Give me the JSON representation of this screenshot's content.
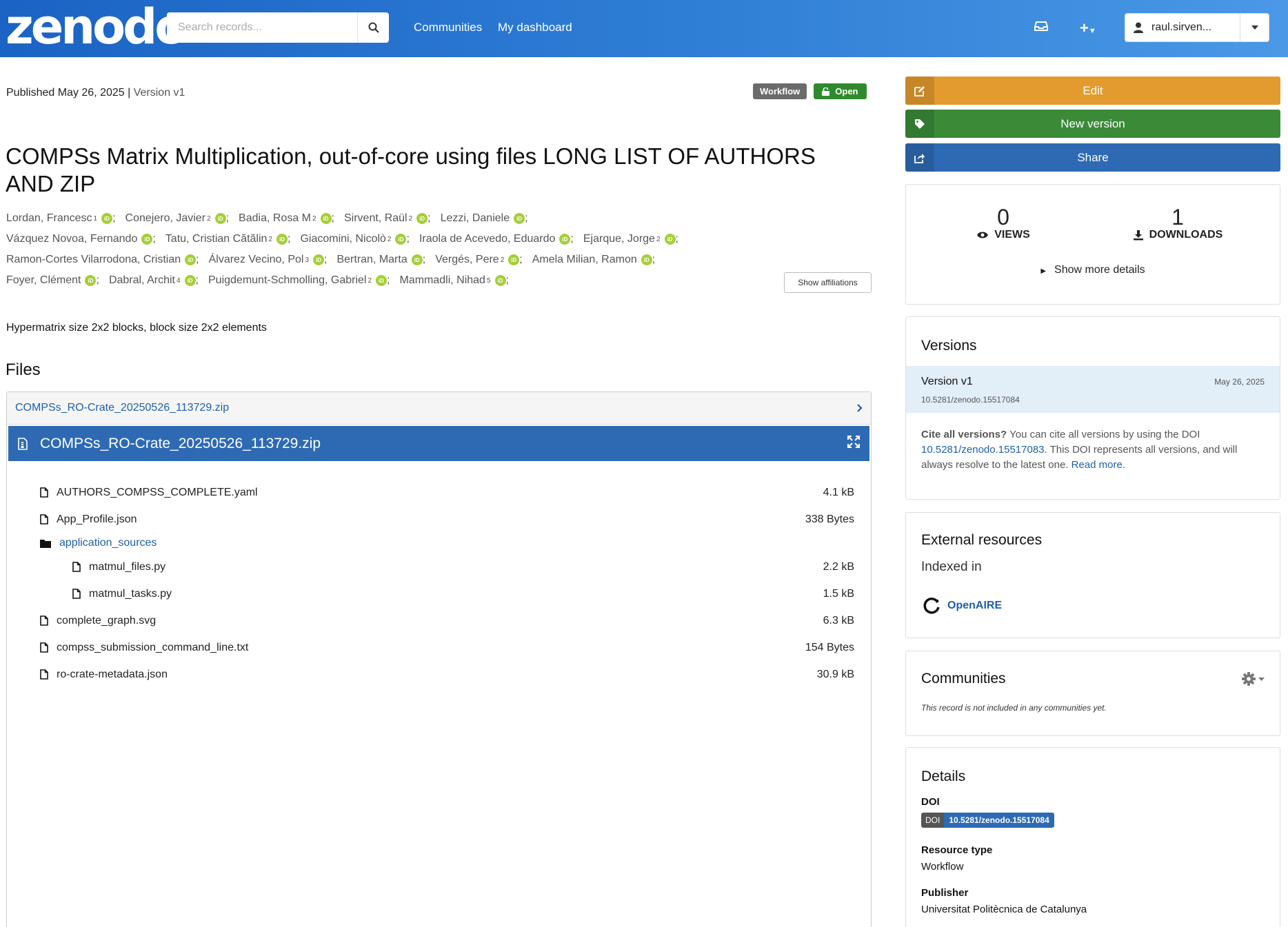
{
  "header": {
    "logo": "zenodo",
    "search_placeholder": "Search records...",
    "nav_communities": "Communities",
    "nav_dashboard": "My dashboard",
    "username": "raul.sirven..."
  },
  "record": {
    "published": "Published May 26, 2025",
    "separator": "|",
    "version": "Version v1",
    "badge_type": "Workflow",
    "badge_access": "Open",
    "title": "COMPSs Matrix Multiplication, out-of-core using files LONG LIST OF AUTHORS AND ZIP",
    "description": "Hypermatrix size 2x2 blocks, block size 2x2 elements",
    "show_affiliations": "Show affiliations",
    "author_lines": [
      [
        {
          "name": "Lordan, Francesc",
          "aff": "1"
        },
        {
          "name": "Conejero, Javier",
          "aff": "2"
        },
        {
          "name": "Badia, Rosa M",
          "aff": "2"
        },
        {
          "name": "Sirvent, Raül",
          "aff": "2"
        },
        {
          "name": "Lezzi, Daniele",
          "aff": ""
        }
      ],
      [
        {
          "name": "Vázquez Novoa, Fernando",
          "aff": ""
        },
        {
          "name": "Tatu, Cristian Cătălin",
          "aff": "2"
        },
        {
          "name": "Giacomini, Nicolò",
          "aff": "2"
        },
        {
          "name": "Iraola de Acevedo, Eduardo",
          "aff": ""
        },
        {
          "name": "Ejarque, Jorge",
          "aff": "2"
        }
      ],
      [
        {
          "name": "Ramon-Cortes Vilarrodona, Cristian",
          "aff": ""
        },
        {
          "name": "Álvarez Vecino, Pol",
          "aff": "3"
        },
        {
          "name": "Bertran, Marta",
          "aff": ""
        },
        {
          "name": "Vergés, Pere",
          "aff": "2"
        },
        {
          "name": "Amela Milian, Ramon",
          "aff": ""
        }
      ],
      [
        {
          "name": "Foyer, Clément",
          "aff": ""
        },
        {
          "name": "Dabral, Archit",
          "aff": "4"
        },
        {
          "name": "Puigdemunt-Schmolling, Gabriel",
          "aff": "2"
        },
        {
          "name": "Mammadli, Nihad",
          "aff": "5"
        }
      ]
    ]
  },
  "files": {
    "heading": "Files",
    "archive_name": "COMPSs_RO-Crate_20250526_113729.zip",
    "preview_title": "COMPSs_RO-Crate_20250526_113729.zip",
    "tree": [
      {
        "name": "AUTHORS_COMPSS_COMPLETE.yaml",
        "size": "4.1 kB",
        "level": 1,
        "kind": "file"
      },
      {
        "name": "App_Profile.json",
        "size": "338 Bytes",
        "level": 1,
        "kind": "file"
      },
      {
        "name": "application_sources",
        "size": "",
        "level": 1,
        "kind": "folder"
      },
      {
        "name": "matmul_files.py",
        "size": "2.2 kB",
        "level": 2,
        "kind": "file"
      },
      {
        "name": "matmul_tasks.py",
        "size": "1.5 kB",
        "level": 2,
        "kind": "file"
      },
      {
        "name": "complete_graph.svg",
        "size": "6.3 kB",
        "level": 1,
        "kind": "file"
      },
      {
        "name": "compss_submission_command_line.txt",
        "size": "154 Bytes",
        "level": 1,
        "kind": "file"
      },
      {
        "name": "ro-crate-metadata.json",
        "size": "30.9 kB",
        "level": 1,
        "kind": "file"
      }
    ]
  },
  "sidebar": {
    "edit": "Edit",
    "new_version": "New version",
    "share": "Share",
    "views_count": "0",
    "views_label": "VIEWS",
    "downloads_count": "1",
    "downloads_label": "DOWNLOADS",
    "show_more": "Show more details",
    "versions_heading": "Versions",
    "version_name": "Version v1",
    "version_doi": "10.5281/zenodo.15517084",
    "version_date": "May 26, 2025",
    "cite_bold": "Cite all versions?",
    "cite_text1": " You can cite all versions by using the DOI ",
    "cite_doi": "10.5281/zenodo.15517083",
    "cite_text2": ". This DOI represents all versions, and will always resolve to the latest one. ",
    "cite_read_more": "Read more.",
    "external_heading": "External resources",
    "indexed_in": "Indexed in",
    "openaire": "OpenAIRE",
    "communities_heading": "Communities",
    "communities_note": "This record is not included in any communities yet.",
    "details_heading": "Details",
    "doi_label": "DOI",
    "doi_key": "DOI",
    "doi_value": "10.5281/zenodo.15517084",
    "resource_type_label": "Resource type",
    "resource_type_value": "Workflow",
    "publisher_label": "Publisher",
    "publisher_value": "Universitat Politècnica de Catalunya"
  },
  "colors": {
    "header_blue": "#2f7fd6",
    "edit_orange": "#e39a2f",
    "new_version_green": "#3a8a38",
    "share_blue": "#2e6ab3",
    "orcid_green": "#a6ce39"
  }
}
